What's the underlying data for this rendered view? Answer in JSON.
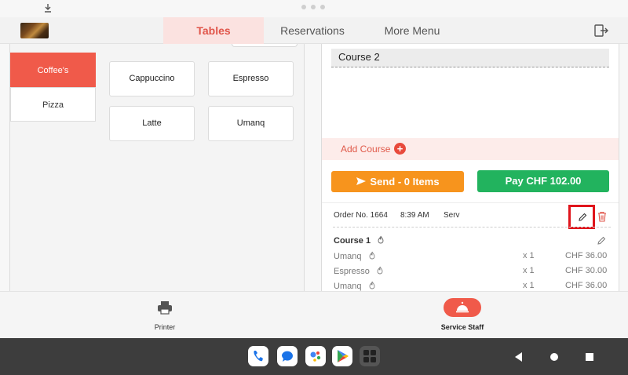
{
  "status_bar": {
    "download_icon": "download-icon"
  },
  "header": {
    "tabs": [
      {
        "label": "Tables",
        "active": true
      },
      {
        "label": "Reservations",
        "active": false
      },
      {
        "label": "More Menu",
        "active": false
      }
    ],
    "logout_icon": "logout-icon"
  },
  "categories": [
    {
      "label": "Coffee's",
      "active": true
    },
    {
      "label": "Pizza",
      "active": false
    }
  ],
  "products": [
    "Cappuccino",
    "Espresso",
    "Latte",
    "Umanq"
  ],
  "order_panel": {
    "course_header": "Course 2",
    "add_course_label": "Add Course",
    "send_button": "Send - 0 Items",
    "pay_button": "Pay CHF 102.00",
    "order": {
      "number": "Order No. 1664",
      "time": "8:39 AM",
      "staff": "Serv"
    },
    "course1_label": "Course 1",
    "items": [
      {
        "name": "Umanq",
        "qty": "x 1",
        "price": "CHF 36.00"
      },
      {
        "name": "Espresso",
        "qty": "x 1",
        "price": "CHF 30.00"
      },
      {
        "name": "Umanq",
        "qty": "x 1",
        "price": "CHF 36.00"
      }
    ]
  },
  "bottom_nav": {
    "printer_label": "Printer",
    "staff_label": "Service Staff"
  },
  "colors": {
    "accent": "#f05a4a",
    "send": "#f7941d",
    "pay": "#22b35e",
    "highlight": "#e0151c"
  }
}
